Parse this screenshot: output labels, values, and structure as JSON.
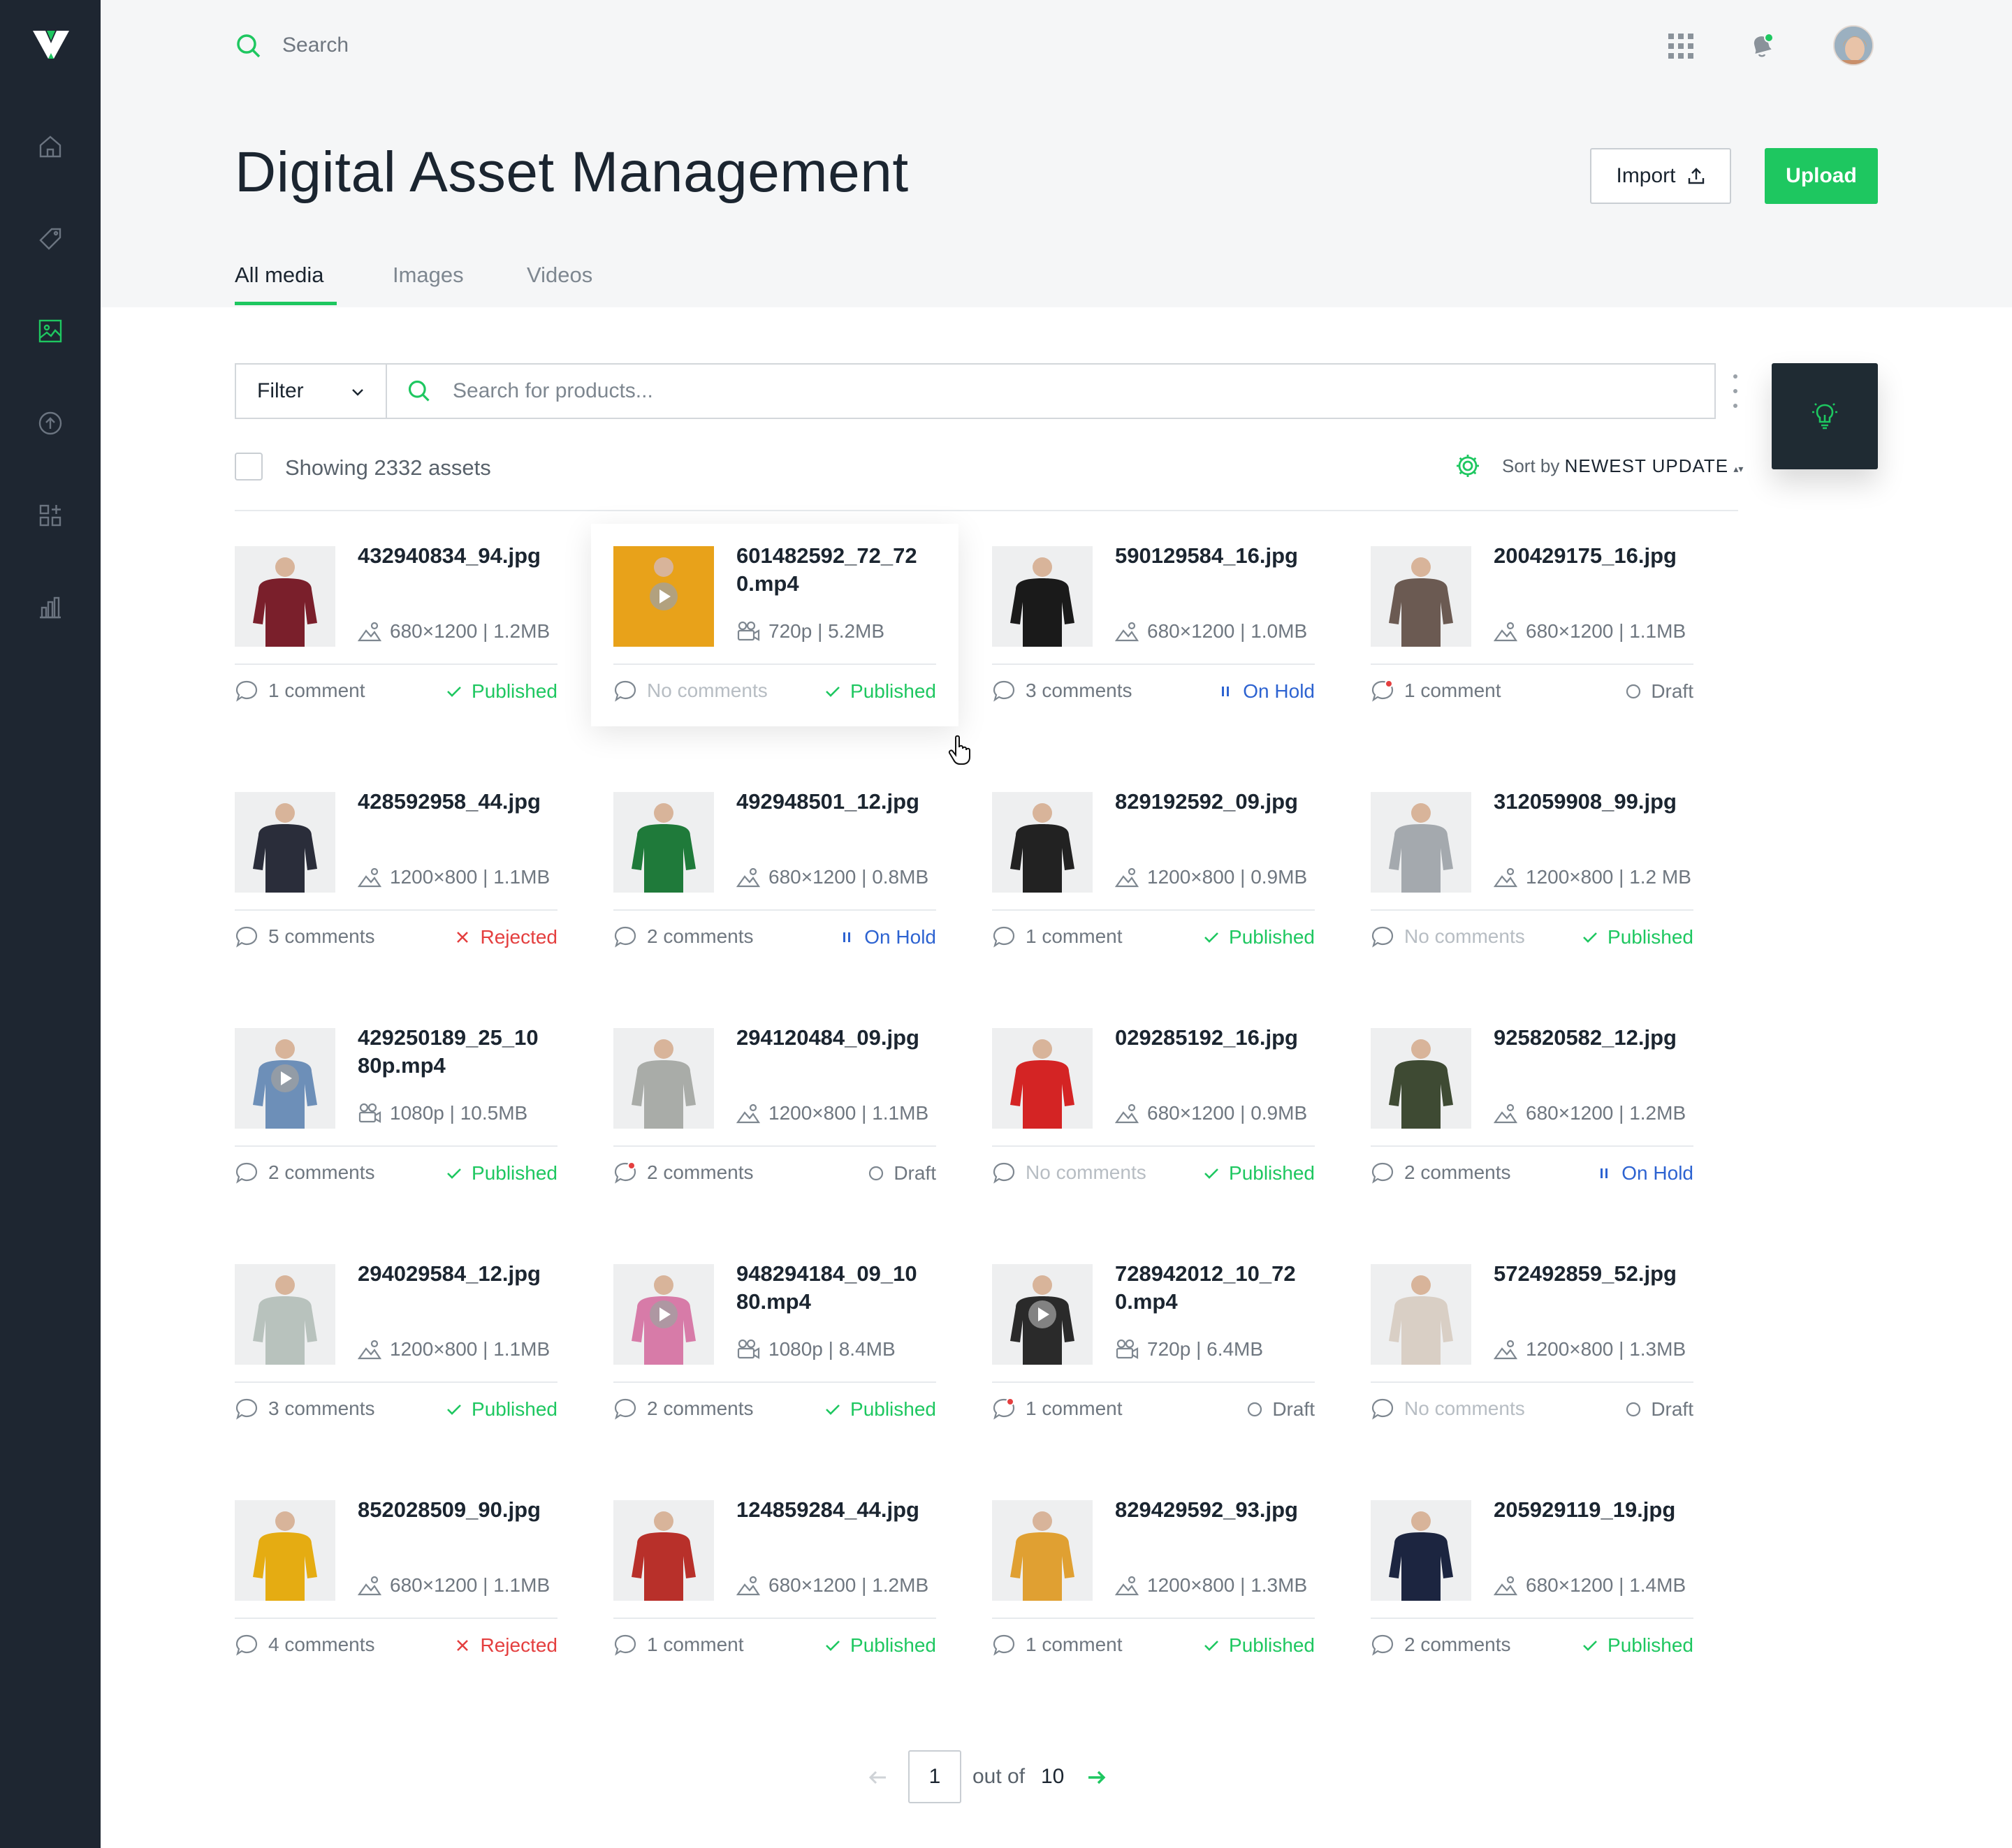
{
  "header": {
    "search_label": "Search",
    "title": "Digital Asset Management",
    "import_label": "Import",
    "upload_label": "Upload"
  },
  "tabs": [
    {
      "label": "All media",
      "active": true
    },
    {
      "label": "Images",
      "active": false
    },
    {
      "label": "Videos",
      "active": false
    }
  ],
  "toolbar": {
    "filter_label": "Filter",
    "search_placeholder": "Search for products...",
    "showing_text": "Showing 2332 assets",
    "sort_prefix": "Sort by",
    "sort_value": "NEWEST UPDATE"
  },
  "sidebar": {
    "items": [
      {
        "icon": "home-icon"
      },
      {
        "icon": "tag-icon"
      },
      {
        "icon": "image-icon",
        "active": true
      },
      {
        "icon": "upload-icon"
      },
      {
        "icon": "widgets-icon"
      },
      {
        "icon": "chart-icon"
      }
    ]
  },
  "colors": {
    "accent": "#1ec760",
    "sidebar": "#1e2631",
    "on_hold": "#2d63d1",
    "rejected": "#e43f3f"
  },
  "assets": [
    {
      "name": "432940834_94.jpg",
      "type": "image",
      "meta": "680×1200 | 1.2MB",
      "comments": "1 comment",
      "status": "Published",
      "thumb": "#7a1f2b"
    },
    {
      "name": "601482592_72_720.mp4",
      "type": "video",
      "meta": "720p | 5.2MB",
      "comments": "No comments",
      "status": "Published",
      "thumb": "#e8a21a"
    },
    {
      "name": "590129584_16.jpg",
      "type": "image",
      "meta": "680×1200 | 1.0MB",
      "comments": "3 comments",
      "status": "On Hold",
      "thumb": "#1a1a1a"
    },
    {
      "name": "200429175_16.jpg",
      "type": "image",
      "meta": "680×1200 | 1.1MB",
      "comments": "1 comment",
      "status": "Draft",
      "thumb": "#6b5a52"
    },
    {
      "name": "428592958_44.jpg",
      "type": "image",
      "meta": "1200×800 | 1.1MB",
      "comments": "5 comments",
      "status": "Rejected",
      "thumb": "#2a2d3a"
    },
    {
      "name": "492948501_12.jpg",
      "type": "image",
      "meta": "680×1200 | 0.8MB",
      "comments": "2 comments",
      "status": "On Hold",
      "thumb": "#1f7a3a"
    },
    {
      "name": "829192592_09.jpg",
      "type": "image",
      "meta": "1200×800 | 0.9MB",
      "comments": "1 comment",
      "status": "Published",
      "thumb": "#222"
    },
    {
      "name": "312059908_99.jpg",
      "type": "image",
      "meta": "1200×800 | 1.2 MB",
      "comments": "No comments",
      "status": "Published",
      "thumb": "#a4a9ae"
    },
    {
      "name": "429250189_25_1080p.mp4",
      "type": "video",
      "meta": "1080p | 10.5MB",
      "comments": "2 comments",
      "status": "Published",
      "thumb": "#6d8fb8"
    },
    {
      "name": "294120484_09.jpg",
      "type": "image",
      "meta": "1200×800 | 1.1MB",
      "comments": "2 comments",
      "status": "Draft",
      "thumb": "#a9aca8"
    },
    {
      "name": "029285192_16.jpg",
      "type": "image",
      "meta": "680×1200 | 0.9MB",
      "comments": "No comments",
      "status": "Published",
      "thumb": "#d42424"
    },
    {
      "name": "925820582_12.jpg",
      "type": "image",
      "meta": "680×1200 | 1.2MB",
      "comments": "2 comments",
      "status": "On Hold",
      "thumb": "#3e4a33"
    },
    {
      "name": "294029584_12.jpg",
      "type": "image",
      "meta": "1200×800 | 1.1MB",
      "comments": "3 comments",
      "status": "Published",
      "thumb": "#b8c2bd"
    },
    {
      "name": "948294184_09_1080.mp4",
      "type": "video",
      "meta": "1080p | 8.4MB",
      "comments": "2 comments",
      "status": "Published",
      "thumb": "#d77ba8"
    },
    {
      "name": "728942012_10_720.mp4",
      "type": "video",
      "meta": "720p | 6.4MB",
      "comments": "1 comment",
      "status": "Draft",
      "thumb": "#2a2a2a"
    },
    {
      "name": "572492859_52.jpg",
      "type": "image",
      "meta": "1200×800 | 1.3MB",
      "comments": "No comments",
      "status": "Draft",
      "thumb": "#d9cfc5"
    },
    {
      "name": "852028509_90.jpg",
      "type": "image",
      "meta": "680×1200 | 1.1MB",
      "comments": "4 comments",
      "status": "Rejected",
      "thumb": "#e5ac12"
    },
    {
      "name": "124859284_44.jpg",
      "type": "image",
      "meta": "680×1200 | 1.2MB",
      "comments": "1 comment",
      "status": "Published",
      "thumb": "#b8302a"
    },
    {
      "name": "829429592_93.jpg",
      "type": "image",
      "meta": "1200×800 | 1.3MB",
      "comments": "1 comment",
      "status": "Published",
      "thumb": "#e0a032"
    },
    {
      "name": "205929119_19.jpg",
      "type": "image",
      "meta": "680×1200 | 1.4MB",
      "comments": "2 comments",
      "status": "Published",
      "thumb": "#1c2540"
    }
  ],
  "pagination": {
    "current": "1",
    "out_of_label": "out of",
    "total": "10"
  }
}
